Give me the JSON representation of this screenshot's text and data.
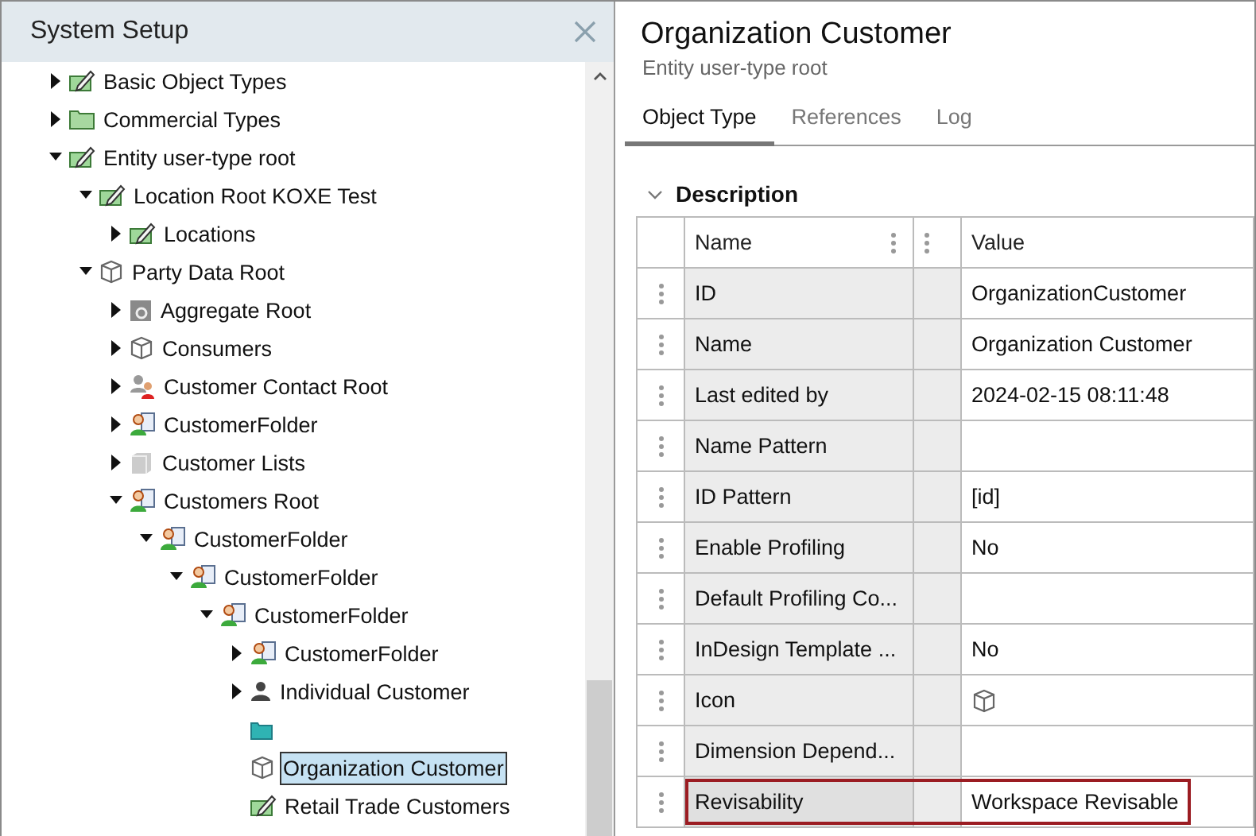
{
  "left_panel": {
    "title": "System Setup"
  },
  "tree": [
    {
      "label": "Basic Object Types",
      "kind": "tagged-folder",
      "expanded": false,
      "selected": false
    },
    {
      "label": "Commercial Types",
      "kind": "folder",
      "expanded": false,
      "selected": false
    },
    {
      "label": "Entity user-type root",
      "kind": "tagged-folder",
      "expanded": true,
      "selected": false,
      "children": [
        {
          "label": "Location Root KOXE Test",
          "kind": "tagged-folder",
          "expanded": true,
          "selected": false,
          "children": [
            {
              "label": "Locations",
              "kind": "tagged-folder",
              "expanded": false,
              "selected": false
            }
          ]
        },
        {
          "label": "Party Data Root",
          "kind": "cube",
          "expanded": true,
          "selected": false,
          "children": [
            {
              "label": "Aggregate Root",
              "kind": "aggregate",
              "expanded": false,
              "selected": false
            },
            {
              "label": "Consumers",
              "kind": "cube",
              "expanded": false,
              "selected": false
            },
            {
              "label": "Customer Contact Root",
              "kind": "contacts",
              "expanded": false,
              "selected": false
            },
            {
              "label": "CustomerFolder",
              "kind": "customer-folder",
              "expanded": false,
              "selected": false
            },
            {
              "label": "Customer Lists",
              "kind": "list",
              "expanded": false,
              "selected": false
            },
            {
              "label": "Customers Root",
              "kind": "customer-folder",
              "expanded": true,
              "selected": false,
              "children": [
                {
                  "label": "CustomerFolder",
                  "kind": "customer-folder",
                  "expanded": true,
                  "selected": false,
                  "children": [
                    {
                      "label": "CustomerFolder",
                      "kind": "customer-folder",
                      "expanded": true,
                      "selected": false,
                      "children": [
                        {
                          "label": "CustomerFolder",
                          "kind": "customer-folder",
                          "expanded": true,
                          "selected": false,
                          "children": [
                            {
                              "label": "CustomerFolder",
                              "kind": "customer-folder",
                              "expanded": false,
                              "selected": false
                            },
                            {
                              "label": "Individual Customer",
                              "kind": "person",
                              "expanded": false,
                              "selected": false
                            },
                            {
                              "kind": "teal-folder",
                              "selected": false
                            },
                            {
                              "label": "Organization Customer",
                              "kind": "cube",
                              "selected": true
                            },
                            {
                              "label": "Retail Trade Customers",
                              "kind": "tagged-folder",
                              "selected": false
                            }
                          ]
                        }
                      ]
                    }
                  ]
                }
              ]
            }
          ]
        }
      ]
    }
  ],
  "detail": {
    "title": "Organization Customer",
    "subtitle": "Entity user-type root"
  },
  "tabs": [
    {
      "label": "Object Type",
      "selected": true
    },
    {
      "label": "References",
      "selected": false
    },
    {
      "label": "Log",
      "selected": false
    }
  ],
  "section": {
    "title": "Description",
    "expanded": true
  },
  "table": {
    "columns": [
      "Name",
      "Value"
    ],
    "rows": [
      {
        "name": "ID",
        "kind": "text",
        "value": "OrganizationCustomer",
        "highlighted": false
      },
      {
        "name": "Name",
        "kind": "text",
        "value": "Organization Customer",
        "highlighted": false
      },
      {
        "name": "Last edited by",
        "kind": "text",
        "value": "2024-02-15 08:11:48",
        "highlighted": false
      },
      {
        "name": "Name Pattern",
        "kind": "text",
        "highlighted": false
      },
      {
        "name": "ID Pattern",
        "kind": "text",
        "value": "[id]",
        "highlighted": false
      },
      {
        "name": "Enable Profiling",
        "kind": "text",
        "value": "No",
        "highlighted": false
      },
      {
        "name": "Default Profiling Co...",
        "kind": "text",
        "highlighted": false
      },
      {
        "name": "InDesign Template ...",
        "kind": "text",
        "value": "No",
        "highlighted": false
      },
      {
        "name": "Icon",
        "kind": "icon",
        "highlighted": false
      },
      {
        "name": "Dimension Depend...",
        "kind": "text",
        "highlighted": false
      },
      {
        "name": "Revisability",
        "kind": "text",
        "value": "Workspace Revisable",
        "highlighted": true
      }
    ]
  }
}
